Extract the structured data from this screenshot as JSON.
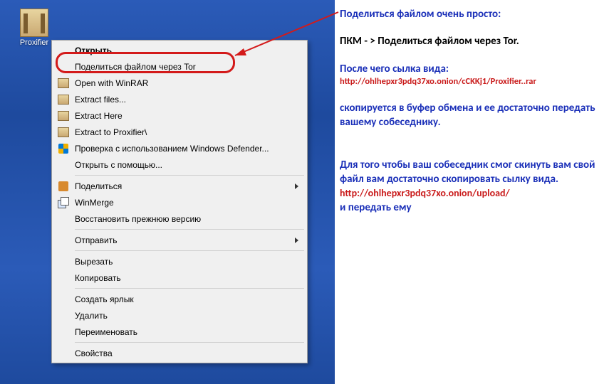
{
  "desktop": {
    "file_label": "Proxifier"
  },
  "menu": {
    "open": "Открыть",
    "share_tor": "Поделиться файлом через Tor",
    "open_winrar": "Open with WinRAR",
    "extract_files": "Extract files...",
    "extract_here": "Extract Here",
    "extract_to": "Extract to Proxifier\\",
    "defender": "Проверка с использованием Windows Defender...",
    "open_with": "Открыть с помощью...",
    "share": "Поделиться",
    "winmerge": "WinMerge",
    "restore": "Восстановить прежнюю версию",
    "send_to": "Отправить",
    "cut": "Вырезать",
    "copy": "Копировать",
    "shortcut": "Создать ярлык",
    "delete": "Удалить",
    "rename": "Переименовать",
    "properties": "Свойства"
  },
  "notes": {
    "l1": "Поделиться файлом очень просто:",
    "l2": "ПКМ - > Поделиться файлом через Tor.",
    "l3": "После чего сылка вида:",
    "url1": "http://ohlhepxr3pdq37xo.onion/cCKKj1/Proxifier..rar",
    "l4": "скопируется в буфер обмена и ее достаточно передать вашему собеседнику.",
    "l5": "Для того чтобы ваш собеседник смог скинуть вам свой файл вам достаточно скопировать сылку вида.",
    "url2": "http://ohlhepxr3pdq37xo.onion/upload/",
    "l6": "и передать ему"
  }
}
